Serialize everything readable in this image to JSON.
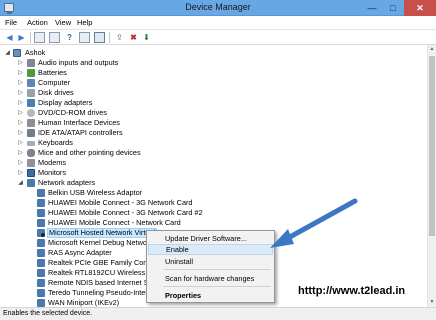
{
  "window": {
    "title": "Device Manager",
    "min": "—",
    "max": "□",
    "close": "✕"
  },
  "menu": [
    "File",
    "Action",
    "View",
    "Help"
  ],
  "tree": {
    "root": "Ashok",
    "categories": [
      "Audio inputs and outputs",
      "Batteries",
      "Computer",
      "Disk drives",
      "Display adapters",
      "DVD/CD-ROM drives",
      "Human Interface Devices",
      "IDE ATA/ATAPI controllers",
      "Keyboards",
      "Mice and other pointing devices",
      "Modems",
      "Monitors",
      "Network adapters"
    ],
    "network_children": [
      "Belkin USB Wireless Adaptor",
      "HUAWEI Mobile Connect - 3G Network Card",
      "HUAWEI Mobile Connect - 3G Network Card #2",
      "HUAWEI Mobile Connect - Network Card",
      "Microsoft Hosted Network Virtual",
      "Microsoft Kernel Debug Network",
      "RAS Async Adapter",
      "Realtek PCIe GBE Family Controll",
      "Realtek RTL8192CU Wireless LAN",
      "Remote NDIS based Internet Shar",
      "Teredo Tunneling Pseudo-Interfa",
      "WAN Miniport (IKEv2)"
    ]
  },
  "context_menu": {
    "update": "Update Driver Software...",
    "enable": "Enable",
    "uninstall": "Uninstall",
    "scan": "Scan for hardware changes",
    "properties": "Properties"
  },
  "status": "Enables the selected device.",
  "watermark": "htttp://www.t2lead.in",
  "colors": {
    "titlebar": "#67a7e6",
    "close": "#c7504b",
    "selection": "#cce8ff",
    "arrow": "#3a78c4"
  },
  "icons": {
    "toolbar": [
      "back-icon",
      "forward-icon",
      "properties-icon",
      "help-icon",
      "scan-icon",
      "update-driver-icon",
      "disable-icon",
      "enable-icon"
    ]
  }
}
